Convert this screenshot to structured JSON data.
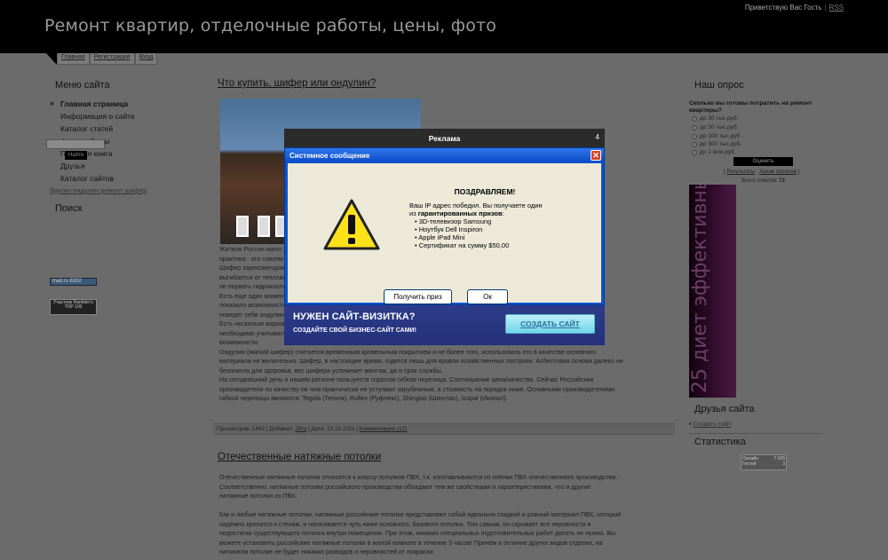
{
  "header": {
    "site_title": "Ремонт квартир, отделочные работы, цены, фото",
    "greeting": "Приветствую Вас Гость",
    "separator": "|",
    "rss": "RSS"
  },
  "nav_tabs": [
    "Главная",
    "Регистрация",
    "Вход"
  ],
  "left_sidebar": {
    "menu_title": "Меню сайта",
    "items": [
      "Главная страница",
      "Информация о сайте",
      "Каталог статей",
      "Фотоальбомы",
      "Гостевая книга",
      "Друзья",
      "Каталог сайтов"
    ],
    "tag_link": "брусин ондулин ремонт шифер",
    "search_title": "Поиск",
    "search_button": "Найти",
    "counter_mail": "mail.ru  6302",
    "counter_rambler": "Участник Rambler's TOP 100"
  },
  "post1": {
    "title": "Что купить, шифер или ондулин?",
    "lines": [
      "Жители России мало знакомы с ондулином, однако этот материал уже давно применяется в мире. Ондулин в теории, но",
      "практика - это совсем другое дело.",
      "Шифер зарекомендовал себя как надежный и недорогой материал, проверенный временем, и его производство",
      "выгибается от теплового расширения и от холода, требует аккуратности в монтаже и дополнительной мансардой чтобы",
      "не порвать гидроизоляцию.",
      "Есть еще один момент, который нужно учитывать при выборе кровельного материала. Зимой 2010-2011 года",
      "показало возможности ондулина, особенно при обильных снегопадах. Многие владельцы до сих пор не понятно как",
      "поведет себя ондулин со временем.",
      "Есть несколько вариантов выбора кровельного покрытия: по качеству, по цене, по весу кровельного материала",
      "необходимо учитывать все факторы, чтобы сделать правильный выбор, соотнеся свои желания и финансовые",
      "возможности.",
      "Ондулин (мягкий шифер) считается временным кровельным покрытием и не более того, использовать его в качестве основного",
      "материала не желательно. Шифер, в настоящее время, годится лишь для кровли хозяйственных построек. Асбестовая основа далеко не",
      "безопасна для здоровья, вес шифера усложняет монтаж, да и срок службы.",
      "На сегодняшний день в нашем регионе пользуется спросом гибкая черепица. Соотношение цена/качество. Сейчас Российские",
      "производители по качеству не чем практически не уступают зарубежным, а стоимость на порядок ниже. Основными производителями",
      "гибкой черепицы являются: Tegola (Тегола), Ruflex (Руфлекс), Shinglas (Шинглас), Icopal (Икопал)."
    ],
    "footer": {
      "views": "Просмотров: 1442",
      "added_label": "Добавил:",
      "author": "29ru",
      "date": "Дата: 13.10.2011",
      "comments": "Комментарии (12)"
    }
  },
  "post2": {
    "title": "Отечественные натяжные потолки",
    "lines": [
      "Отечественные натяжные потолки относятся к классу потолков ПВХ, т.к.  изготавливаются из плёнки ПВХ отечественного производства.",
      "Соответственно, натяжные потолки российского производства обладают тем же свойствами и характеристиками, что и другие",
      "натяжные потолки из ПВХ.",
      "",
      "Как и любые натяжные потолки, натяжные российские потолки представляют собой идеально гладкий и ровный материал ПВХ, который",
      "надёжно крепится к стенам, и натягивается чуть ниже основного, базового потолка. Тем самым, он скрывает все неровности и",
      "недостатки существующего потолка внутри помещения. При этом, никаких специальных подготовительных работ делать не нужно. Вы",
      "можете установить российские натяжные потолки в жилой комнате в течение 3 часов! Причём в отличие других видов отделки, на",
      "натяжном потолке не будет никаких разводов и неровностей от покраски."
    ]
  },
  "right_sidebar": {
    "poll_title": "Наш опрос",
    "poll_question": "Сколько вы готовы потратить на ремонт квартиры?",
    "poll_options": [
      "до 30 тыс.руб.",
      "до 50 тыс.руб.",
      "до 100 тыс.руб .",
      "до 300 тыс.руб.",
      "до 1 млн.руб."
    ],
    "vote_button": "Оценить",
    "results_link": "Результаты",
    "archive_link": "Архив опросов",
    "total_votes_label": "Всего ответов:",
    "total_votes": "72",
    "diet_ad_text": "25 диет эффективных",
    "friends_title": "Друзья сайта",
    "friends_link": "Создать сайт",
    "stats_title": "Статистика",
    "stats_row1_label": "Онлайн",
    "stats_row1_value": "7 035",
    "stats_row2_label": "Гостей",
    "stats_row2_value": "3"
  },
  "ad_popup": {
    "header": "Реклама",
    "counter": "4",
    "window_title": "Системное сообщение",
    "close": "✕",
    "congrats": "ПОЗДРАВЛЯЕМ!",
    "line1": "Ваш IP адрес победил. Вы получаете один",
    "line2_prefix": "из",
    "line2_bold": "гарантированных призов",
    "line2_suffix": ":",
    "prizes": [
      "3D-телевизор Samsung",
      "Ноутбук Dell Inspiron",
      "Apple iPad Mini",
      "Сертификат на сумму $50,00"
    ],
    "get_prize_button": "Получить приз",
    "ok_button": "Ок",
    "promo_title": "НУЖЕН САЙТ-ВИЗИТКА?",
    "promo_subtitle": "СОЗДАЙТЕ СВОЙ БИЗНЕС-САЙТ САМИ!",
    "promo_button": "СОЗДАТЬ САЙТ"
  }
}
